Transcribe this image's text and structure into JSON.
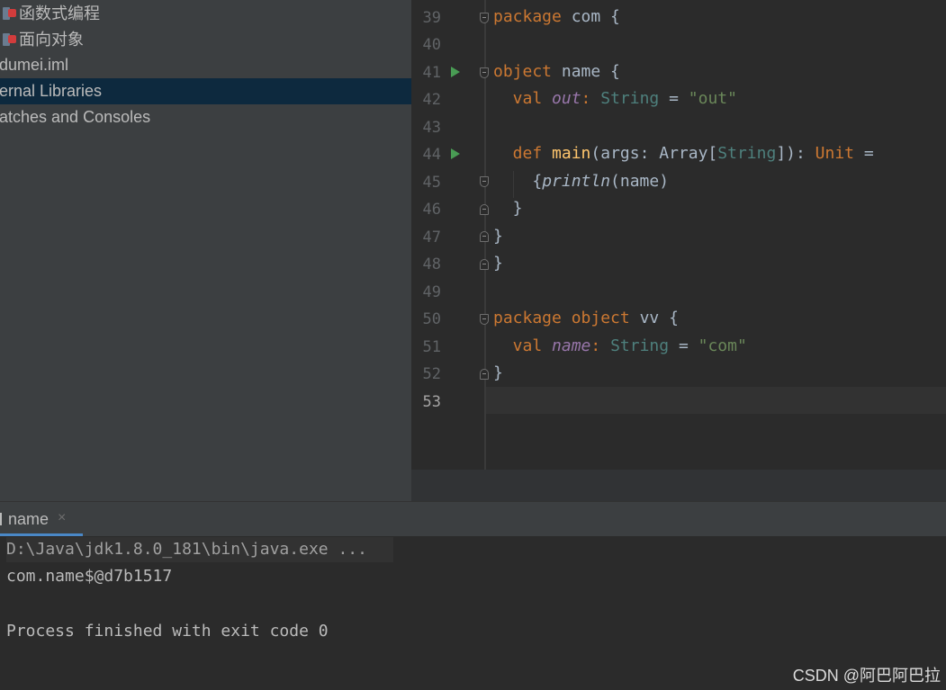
{
  "project_tree": {
    "items": [
      {
        "label": "函数式编程",
        "icon": "package-icon"
      },
      {
        "label": "面向对象",
        "icon": "package-icon"
      },
      {
        "label": "dumei.iml"
      },
      {
        "label": "ernal Libraries"
      },
      {
        "label": "atches and Consoles"
      }
    ]
  },
  "editor": {
    "line_numbers": [
      "39",
      "40",
      "41",
      "42",
      "43",
      "44",
      "45",
      "46",
      "47",
      "48",
      "49",
      "50",
      "51",
      "52",
      "53"
    ],
    "code": {
      "l39": {
        "kw": "package",
        "rest": " com {"
      },
      "l41": {
        "kw": "object",
        "rest": " name {"
      },
      "l42": {
        "kw": "  val ",
        "field": "out",
        "colon": ": ",
        "type": "String",
        "eq": " = ",
        "str": "\"out\""
      },
      "l44": {
        "kw": "  def ",
        "fn": "main",
        "p1": "(args: Array[",
        "type": "String",
        "p2": "]): ",
        "unit": "Unit",
        "p3": " ="
      },
      "l45": {
        "pre": "    {",
        "fn": "println",
        "post": "(name)"
      },
      "l46": "  }",
      "l47": "}",
      "l48": "}",
      "l50": {
        "kw1": "package",
        "sp": " ",
        "kw2": "object",
        "rest": " vv {"
      },
      "l51": {
        "kw": "  val ",
        "field": "name",
        "colon": ": ",
        "type": "String",
        "eq": " = ",
        "str": "\"com\""
      },
      "l52": "}"
    }
  },
  "run_panel": {
    "tab_label": "name",
    "close_glyph": "×",
    "console": [
      "D:\\Java\\jdk1.8.0_181\\bin\\java.exe ...",
      "com.name$@d7b1517",
      "",
      "Process finished with exit code 0"
    ]
  },
  "watermark": "CSDN @阿巴阿巴拉",
  "colors": {
    "keyword": "#cc7832",
    "string": "#6a8759",
    "type": "#4e807d",
    "field": "#9876aa",
    "function": "#ffc66d",
    "selection": "#0d293e",
    "run_icon": "#499c54"
  }
}
